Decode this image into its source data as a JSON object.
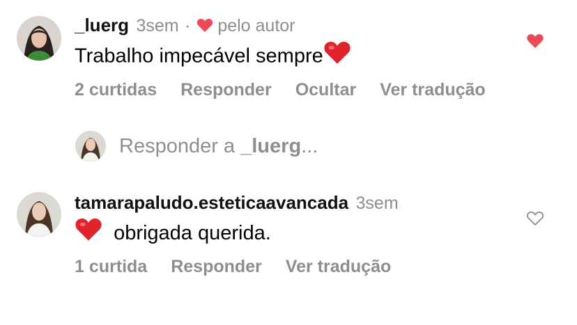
{
  "comments": [
    {
      "username": "_luerg",
      "time": "3sem",
      "separator": "·",
      "author_like_label": "pelo autor",
      "text": "Trabalho impecável sempre",
      "emoji": "❤️",
      "likes": "2 curtidas",
      "reply": "Responder",
      "hide": "Ocultar",
      "translate": "Ver tradução",
      "liked": true
    },
    {
      "username": "tamarapaludo.esteticaavancada",
      "time": "3sem",
      "emoji": "❤️",
      "text": "obrigada querida.",
      "likes": "1 curtida",
      "reply": "Responder",
      "translate": "Ver tradução",
      "liked": false
    }
  ],
  "reply_box": {
    "prefix": "Responder a",
    "target": "_luerg",
    "ellipsis": "..."
  },
  "colors": {
    "like_red": "#ed4956",
    "muted": "#8e8e8e"
  },
  "icons": {
    "like_filled": "heart-filled-icon",
    "like_outline": "heart-outline-icon"
  }
}
